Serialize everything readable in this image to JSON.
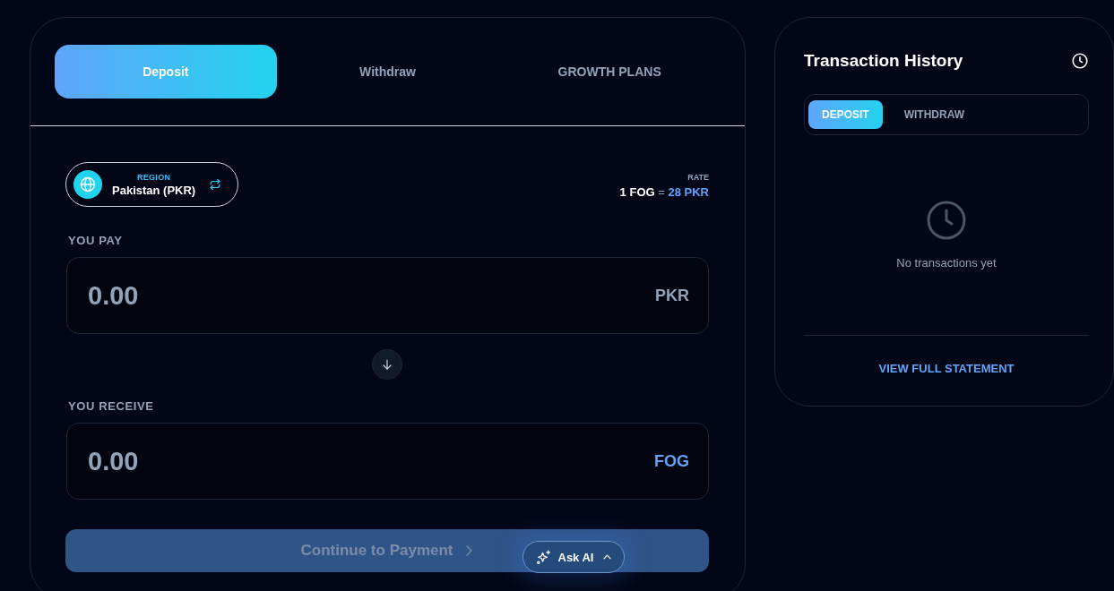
{
  "exchange": {
    "tabs": [
      {
        "label": "Deposit",
        "selected": true
      },
      {
        "label": "Withdraw",
        "selected": false
      },
      {
        "label": "GROWTH PLANS",
        "selected": false
      }
    ],
    "region": {
      "label": "REGION",
      "value": "Pakistan (PKR)"
    },
    "rate": {
      "label": "RATE",
      "base": "1 FOG",
      "separator": "=",
      "quote": "28 PKR"
    },
    "fields": [
      {
        "label": "YOU PAY",
        "placeholder": "0.00",
        "currency": "PKR",
        "currency_highlighted": false
      },
      {
        "label": "YOU RECEIVE",
        "placeholder": "0.00",
        "currency": "FOG",
        "currency_highlighted": true
      }
    ],
    "continue_button": {
      "label": "Continue to Payment",
      "disabled": true
    }
  },
  "history": {
    "title": "Transaction History",
    "tabs": [
      {
        "label": "DEPOSIT",
        "selected": true
      },
      {
        "label": "WITHDRAW",
        "selected": false
      }
    ],
    "empty_message": "No transactions yet",
    "link": "VIEW FULL STATEMENT"
  },
  "ask_ai": {
    "label": "Ask AI"
  }
}
